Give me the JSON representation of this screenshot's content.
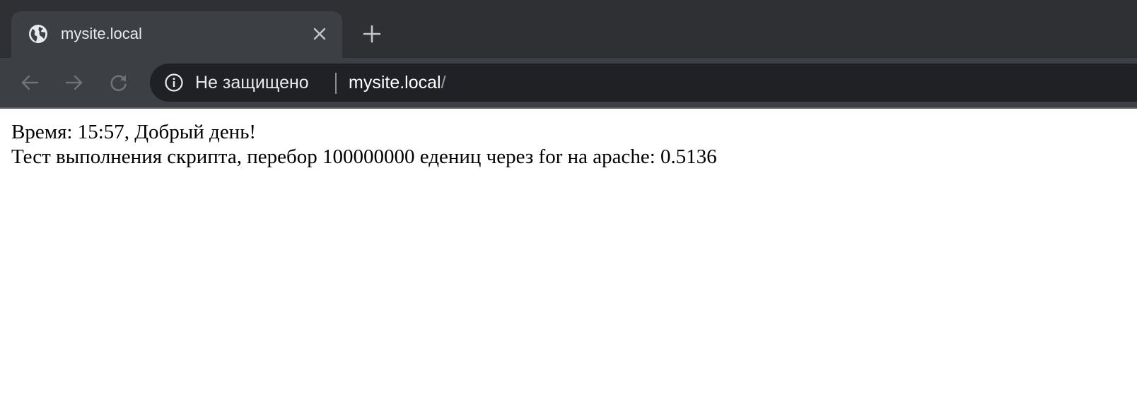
{
  "browser": {
    "colors": {
      "tabstrip": "#2f3033",
      "active_tab": "#3c3f43",
      "toolbar": "#3c3f43",
      "omnibox": "#202124",
      "text": "#e8eaed",
      "icon": "#9aa0a6"
    },
    "tab": {
      "favicon": "globe-icon",
      "title": "mysite.local",
      "close_icon": "close-icon"
    },
    "new_tab_icon": "plus-icon",
    "nav": {
      "back_icon": "arrow-left-icon",
      "forward_icon": "arrow-right-icon",
      "reload_icon": "reload-icon"
    },
    "omnibox": {
      "info_icon": "info-icon",
      "security_label": "Не защищено",
      "url_host": "mysite.local",
      "url_path": "/"
    }
  },
  "page": {
    "lines": [
      "Время: 15:57, Добрый день!",
      "Тест выполнения скрипта, перебор 100000000 едениц через for на apache: 0.5136"
    ]
  }
}
